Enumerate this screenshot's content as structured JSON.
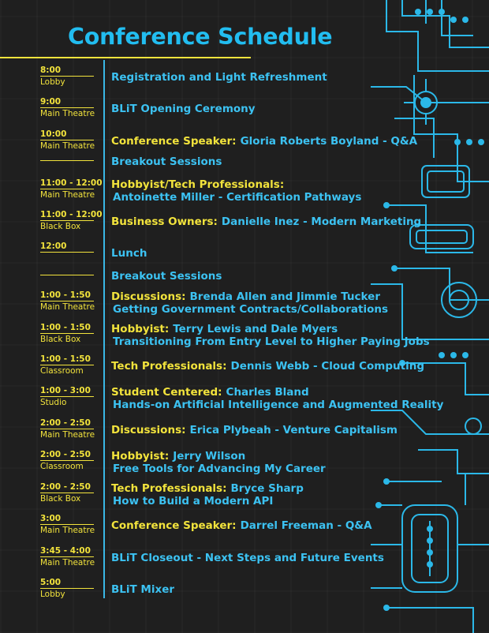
{
  "title": "Conference Schedule",
  "colors": {
    "accent": "#3cc2f2",
    "highlight": "#f2e33c",
    "background": "#1f1f1f"
  },
  "entries": [
    {
      "time": "8:00",
      "room": "Lobby",
      "label": "",
      "line1": "Registration and Light Refreshment",
      "line2": ""
    },
    {
      "time": "9:00",
      "room": "Main Theatre",
      "label": "",
      "line1": "BLiT Opening Ceremony",
      "line2": ""
    },
    {
      "time": "10:00",
      "room": "Main Theatre",
      "label": "Conference Speaker:",
      "line1": "Gloria Roberts Boyland - Q&A",
      "line2": ""
    },
    {
      "time": "",
      "room": "",
      "label": "",
      "line1": "Breakout Sessions",
      "line2": ""
    },
    {
      "time": "11:00 - 12:00",
      "room": "Main Theatre",
      "label": "Hobbyist/Tech Professionals:",
      "line1": "",
      "line2": "Antoinette Miller - Certification Pathways"
    },
    {
      "time": "11:00 - 12:00",
      "room": "Black Box",
      "label": "Business Owners:",
      "line1": "Danielle Inez - Modern Marketing",
      "line2": ""
    },
    {
      "time": "12:00",
      "room": "",
      "label": "",
      "line1": "Lunch",
      "line2": ""
    },
    {
      "time": "",
      "room": "",
      "label": "",
      "line1": "Breakout Sessions",
      "line2": ""
    },
    {
      "time": "1:00 - 1:50",
      "room": "Main Theatre",
      "label": "Discussions:",
      "line1": "Brenda Allen and Jimmie Tucker",
      "line2": "Getting Government Contracts/Collaborations"
    },
    {
      "time": "1:00 - 1:50",
      "room": "Black Box",
      "label": "Hobbyist:",
      "line1": "Terry Lewis and Dale Myers",
      "line2": "Transitioning From Entry Level to Higher Paying Jobs"
    },
    {
      "time": "1:00 - 1:50",
      "room": "Classroom",
      "label": "Tech Professionals:",
      "line1": "Dennis Webb - Cloud Computing",
      "line2": ""
    },
    {
      "time": "1:00 - 3:00",
      "room": "Studio",
      "label": "Student Centered:",
      "line1": "Charles Bland",
      "line2": "Hands-on Artificial Intelligence and Augmented Reality"
    },
    {
      "time": "2:00 - 2:50",
      "room": "Main Theatre",
      "label": "Discussions:",
      "line1": "Erica Plybeah - Venture Capitalism",
      "line2": ""
    },
    {
      "time": "2:00 - 2:50",
      "room": "Classroom",
      "label": "Hobbyist:",
      "line1": "Jerry Wilson",
      "line2": "Free Tools for Advancing My Career"
    },
    {
      "time": "2:00 - 2:50",
      "room": "Black Box",
      "label": "Tech Professionals:",
      "line1": "Bryce Sharp",
      "line2": "How to Build a Modern API"
    },
    {
      "time": "3:00",
      "room": "Main Theatre",
      "label": "Conference Speaker:",
      "line1": "Darrel Freeman - Q&A",
      "line2": ""
    },
    {
      "time": "3:45 - 4:00",
      "room": "Main Theatre",
      "label": "",
      "line1": "BLiT Closeout - Next Steps and Future Events",
      "line2": ""
    },
    {
      "time": "5:00",
      "room": "Lobby",
      "label": "",
      "line1": "BLiT Mixer",
      "line2": ""
    }
  ]
}
